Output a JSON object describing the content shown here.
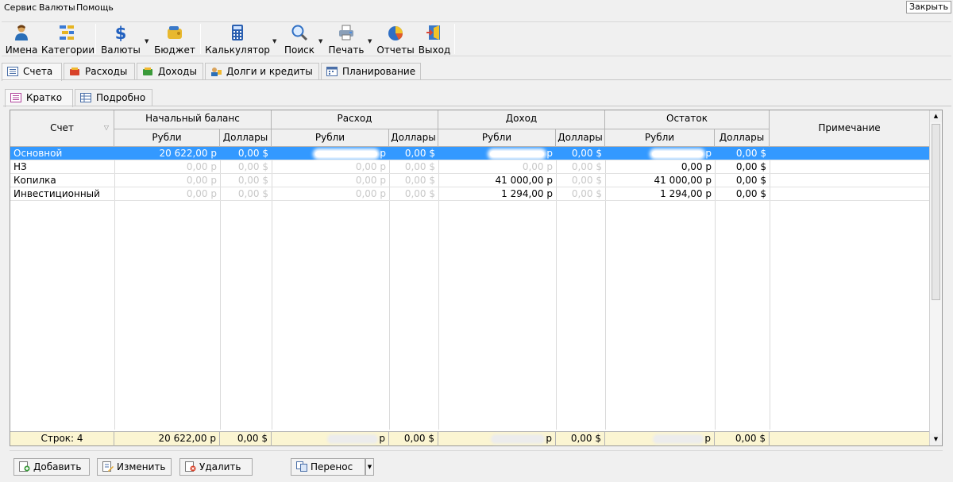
{
  "menu": {
    "items": [
      "Сервис",
      "Валюты",
      "Помощь"
    ],
    "close_label": "Закрыть"
  },
  "toolbar": {
    "names": "Имена",
    "categories": "Категории",
    "currencies": "Валюты",
    "budget": "Бюджет",
    "calculator": "Калькулятор",
    "search": "Поиск",
    "print": "Печать",
    "reports": "Отчеты",
    "exit": "Выход"
  },
  "tabs": [
    "Счета",
    "Расходы",
    "Доходы",
    "Долги и кредиты",
    "Планирование"
  ],
  "subtabs": [
    "Кратко",
    "Подробно"
  ],
  "table": {
    "col_account": "Счет",
    "group_opening": "Начальный баланс",
    "group_expense": "Расход",
    "group_income": "Доход",
    "group_balance": "Остаток",
    "col_note": "Примечание",
    "rub": "Рубли",
    "usd": "Доллары",
    "rows": [
      {
        "name": "Основной",
        "open_rub": "20 622,00 р",
        "open_usd": "0,00 $",
        "exp_rub": "",
        "exp_usd": "0,00 $",
        "inc_rub": "",
        "inc_usd": "0,00 $",
        "bal_rub": "",
        "bal_usd": "0,00 $"
      },
      {
        "name": "НЗ",
        "open_rub": "0,00 р",
        "open_usd": "0,00 $",
        "exp_rub": "0,00 р",
        "exp_usd": "0,00 $",
        "inc_rub": "0,00 р",
        "inc_usd": "0,00 $",
        "bal_rub": "0,00 р",
        "bal_usd": "0,00 $"
      },
      {
        "name": "Копилка",
        "open_rub": "0,00 р",
        "open_usd": "0,00 $",
        "exp_rub": "0,00 р",
        "exp_usd": "0,00 $",
        "inc_rub": "41 000,00 р",
        "inc_usd": "0,00 $",
        "bal_rub": "41 000,00 р",
        "bal_usd": "0,00 $"
      },
      {
        "name": "Инвестиционный",
        "open_rub": "0,00 р",
        "open_usd": "0,00 $",
        "exp_rub": "0,00 р",
        "exp_usd": "0,00 $",
        "inc_rub": "1 294,00 р",
        "inc_usd": "0,00 $",
        "bal_rub": "1 294,00 р",
        "bal_usd": "0,00 $"
      }
    ],
    "footer": {
      "rows_label": "Строк: 4",
      "open_rub": "20 622,00 р",
      "open_usd": "0,00 $",
      "exp_usd": "0,00 $",
      "inc_usd": "0,00 $",
      "bal_usd": "0,00 $"
    }
  },
  "actions": {
    "add": "Добавить",
    "edit": "Изменить",
    "delete": "Удалить",
    "transfer": "Перенос"
  },
  "colors": {
    "selection": "#3399ff",
    "footer_bg": "#fbf5d2"
  }
}
